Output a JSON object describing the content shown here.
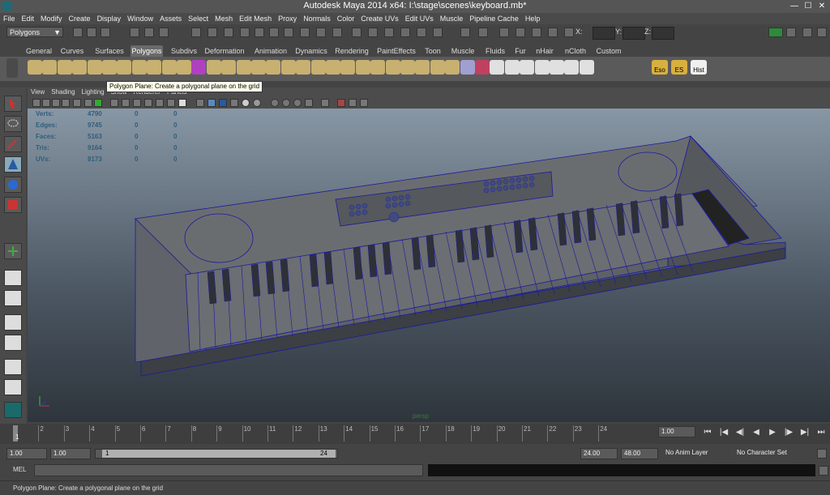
{
  "window": {
    "title": "Autodesk Maya 2014 x64: I:\\stage\\scenes\\keyboard.mb*"
  },
  "window_controls": {
    "minimize": "—",
    "maximize": "☐",
    "close": "✕"
  },
  "menu": [
    "File",
    "Edit",
    "Modify",
    "Create",
    "Display",
    "Window",
    "Assets",
    "Select",
    "Mesh",
    "Edit Mesh",
    "Proxy",
    "Normals",
    "Color",
    "Create UVs",
    "Edit UVs",
    "Muscle",
    "Pipeline Cache",
    "Help"
  ],
  "status_line": {
    "menu_set": "Polygons",
    "dropdown_arrow": "▼",
    "x_label": "X:",
    "y_label": "Y:",
    "z_label": "Z:",
    "x_value": "",
    "y_value": "",
    "z_value": ""
  },
  "shelf": {
    "tabs": [
      "General",
      "Curves",
      "Surfaces",
      "Polygons",
      "Subdivs",
      "Deformation",
      "Animation",
      "Dynamics",
      "Rendering",
      "PaintEffects",
      "Toon",
      "Muscle",
      "Fluids",
      "Fur",
      "nHair",
      "nCloth",
      "Custom"
    ],
    "active_tab": "Polygons",
    "labeled_icons": [
      "Eso",
      "ES",
      "Hist"
    ]
  },
  "tooltip": "Polygon Plane: Create a polygonal plane on the grid",
  "panel_menu": [
    "View",
    "Shading",
    "Lighting",
    "Show",
    "Renderer",
    "Panels"
  ],
  "hud": {
    "rows": [
      {
        "label": "Verts:",
        "v1": "4790",
        "v2": "0",
        "v3": "0"
      },
      {
        "label": "Edges:",
        "v1": "9745",
        "v2": "0",
        "v3": "0"
      },
      {
        "label": "Faces:",
        "v1": "5163",
        "v2": "0",
        "v3": "0"
      },
      {
        "label": "Tris:",
        "v1": "9164",
        "v2": "0",
        "v3": "0"
      },
      {
        "label": "UVs:",
        "v1": "8173",
        "v2": "0",
        "v3": "0"
      }
    ]
  },
  "camera_name": "persp",
  "time_slider": {
    "ticks": [
      "1",
      "2",
      "3",
      "4",
      "5",
      "6",
      "7",
      "8",
      "9",
      "10",
      "11",
      "12",
      "13",
      "14",
      "15",
      "16",
      "17",
      "18",
      "19",
      "20",
      "21",
      "22",
      "23",
      "24"
    ],
    "current_frame": "1",
    "current_time": "1.00",
    "playback": {
      "start": "⏮",
      "prev_key": "|◀",
      "step_back": "◀|",
      "play_back": "◀",
      "play_fwd": "▶",
      "step_fwd": "|▶",
      "next_key": "▶|",
      "end": "⏭"
    }
  },
  "range": {
    "start_time": "1.00",
    "playback_start": "1.00",
    "slider_start": "1",
    "slider_end": "24",
    "playback_end": "24.00",
    "end_time": "48.00",
    "anim_layer": "No Anim Layer",
    "character_set": "No Character Set"
  },
  "command_line": {
    "label": "MEL",
    "input": "",
    "result": ""
  },
  "help_line": "Polygon Plane: Create a polygonal plane on the grid"
}
